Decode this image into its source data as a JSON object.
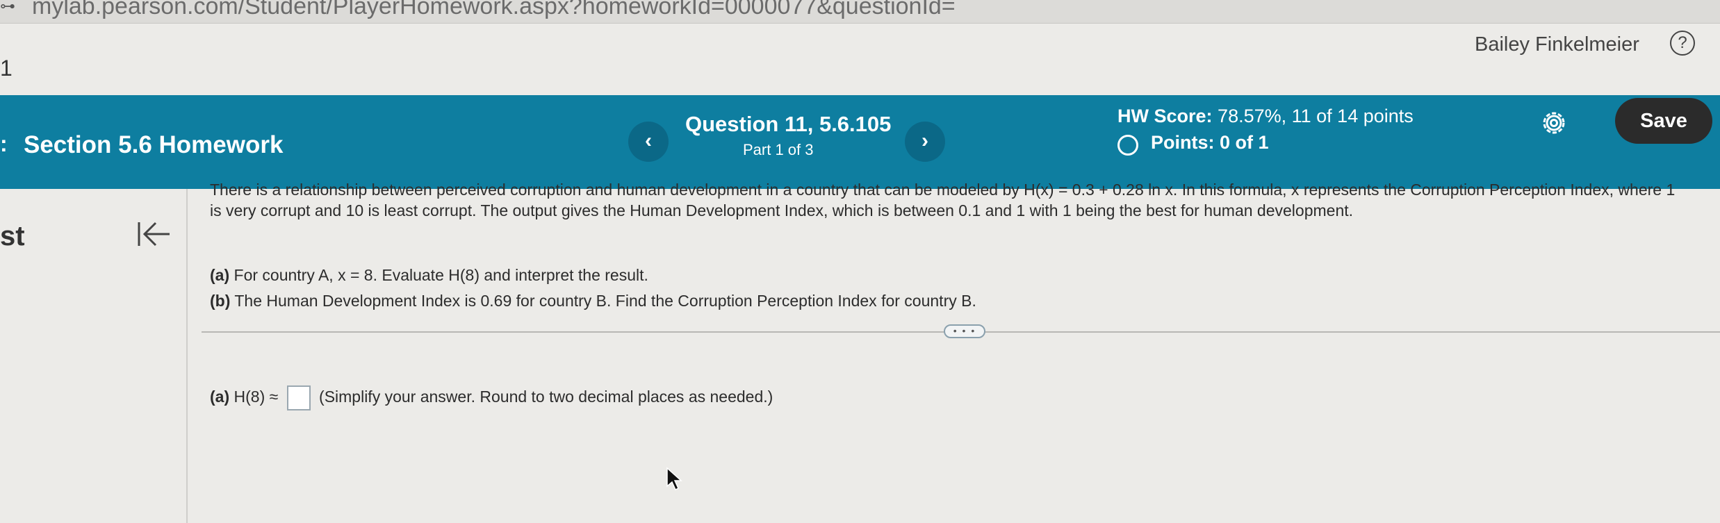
{
  "browser": {
    "url": "mylab.pearson.com/Student/PlayerHomework.aspx?homeworkId=0000077&questionId="
  },
  "edge": {
    "page_number": "1",
    "left_text": "st"
  },
  "user": {
    "name": "Bailey Finkelmeier",
    "help_icon": "help-circle-icon"
  },
  "header": {
    "section_title": "Section 5.6 Homework",
    "prev_label": "‹",
    "next_label": "›",
    "question_title": "Question 11, 5.6.105",
    "question_part": "Part 1 of 3",
    "hw_score_label": "HW Score:",
    "hw_score_value": "78.57%, 11 of 14 points",
    "points": "Points: 0 of 1",
    "save_label": "Save",
    "settings_icon": "gear-icon"
  },
  "question": {
    "text": "There is a relationship between perceived corruption and human development in a country that can be modeled by H(x) = 0.3 + 0.28 ln x. In this formula, x represents the Corruption Perception Index, where 1 is very corrupt and 10 is least corrupt. The output gives the Human Development Index, which is between 0.1 and 1 with 1 being the best for human development.",
    "part_a_label": "(a)",
    "part_a_text": "For country A, x = 8. Evaluate H(8) and interpret the result.",
    "part_b_label": "(b)",
    "part_b_text": "The Human Development Index is 0.69 for country B. Find the Corruption Perception Index for country B.",
    "expand_label": "• • •"
  },
  "answer": {
    "label": "(a)",
    "prefix": "H(8) ≈",
    "instruction": "(Simplify your answer. Round to two decimal places as needed.)"
  }
}
